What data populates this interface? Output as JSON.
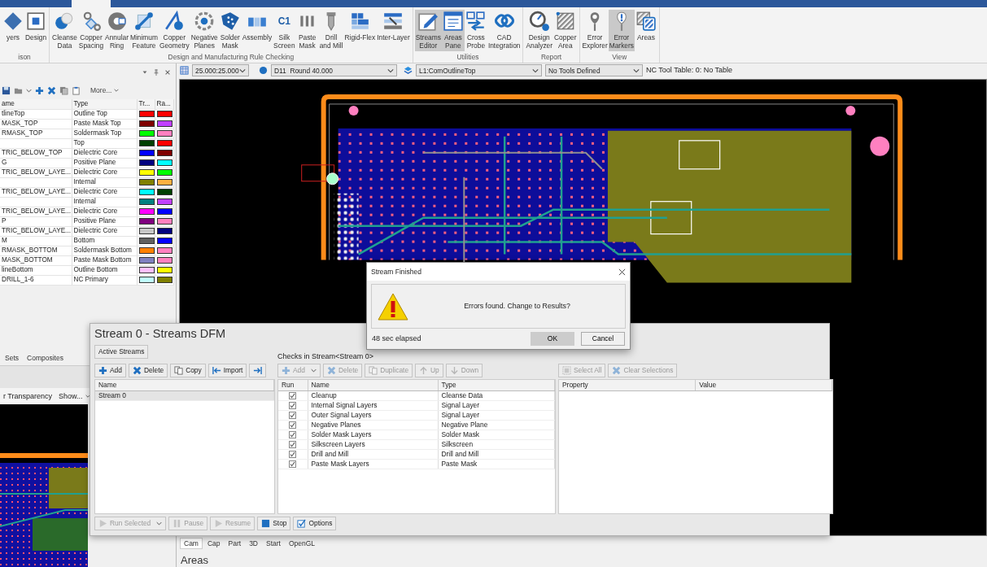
{
  "ribbon": {
    "groups": [
      {
        "label": "ison",
        "buttons": [
          {
            "label": "yers",
            "pressed": false
          },
          {
            "label": "Design",
            "pressed": false
          }
        ]
      },
      {
        "label": "Design and Manufacturing Rule Checking",
        "buttons": [
          {
            "label": "Cleanse\nData",
            "pressed": false
          },
          {
            "label": "Copper\nSpacing",
            "pressed": false
          },
          {
            "label": "Annular\nRing",
            "pressed": false
          },
          {
            "label": "Minimum\nFeature",
            "pressed": false
          },
          {
            "label": "Copper\nGeometry",
            "pressed": false
          },
          {
            "label": "Negative\nPlanes",
            "pressed": false
          },
          {
            "label": "Solder\nMask",
            "pressed": false
          },
          {
            "label": "Assembly",
            "pressed": false
          },
          {
            "label": "Silk\nScreen",
            "icon_text": "C1",
            "pressed": false
          },
          {
            "label": "Paste\nMask",
            "pressed": false
          },
          {
            "label": "Drill\nand Mill",
            "pressed": false
          },
          {
            "label": "Rigid-Flex",
            "pressed": false
          },
          {
            "label": "Inter-Layer",
            "pressed": false
          }
        ]
      },
      {
        "label": "Utilities",
        "buttons": [
          {
            "label": "Streams\nEditor",
            "pressed": true
          },
          {
            "label": "Areas\nPane",
            "pressed": true
          },
          {
            "label": "Cross\nProbe",
            "pressed": false
          },
          {
            "label": "CAD\nIntegration",
            "pressed": false
          }
        ]
      },
      {
        "label": "Report",
        "buttons": [
          {
            "label": "Design\nAnalyzer",
            "pressed": false
          },
          {
            "label": "Copper\nArea",
            "pressed": false
          }
        ]
      },
      {
        "label": "View",
        "buttons": [
          {
            "label": "Error\nExplorer",
            "pressed": false
          },
          {
            "label": "Error\nMarkers",
            "pressed": true
          },
          {
            "label": "Areas",
            "pressed": false
          }
        ]
      }
    ]
  },
  "toolbar": {
    "grid": "25.000:25.000",
    "dcode": "D11  Round 40.000",
    "layer": "L1:ComOutlineTop",
    "tools": "No Tools Defined",
    "nc_tool_table": "NC Tool Table: 0: No Table"
  },
  "layers_panel": {
    "more": "More...",
    "columns": [
      "ame",
      "Type",
      "Tr...",
      "Ra..."
    ],
    "rows": [
      {
        "name": "tlineTop",
        "type": "Outline Top",
        "colors": [
          {
            "color": "#ff0000"
          },
          {
            "color": "#ff0000"
          }
        ]
      },
      {
        "name": "MASK_TOP",
        "type": "Paste Mask Top",
        "colors": [
          {
            "color": "#800000"
          },
          {
            "color": "#c040ff"
          }
        ]
      },
      {
        "name": "RMASK_TOP",
        "type": "Soldermask Top",
        "colors": [
          {
            "color": "#00ff00"
          },
          {
            "color": "#ff80c0"
          }
        ]
      },
      {
        "type": "Top",
        "colors": [
          {
            "color": "#004000"
          },
          {
            "color": "#ff0000"
          }
        ]
      },
      {
        "name": "TRIC_BELOW_TOP",
        "type": "Dielectric Core",
        "colors": [
          {
            "color": "#0000ff"
          },
          {
            "color": "#800000"
          }
        ]
      },
      {
        "name": "G",
        "type": "Positive Plane",
        "colors": [
          {
            "color": "#000080"
          },
          {
            "color": "#00ffff"
          }
        ]
      },
      {
        "name": "TRIC_BELOW_LAYE...",
        "type": "Dielectric Core",
        "colors": [
          {
            "color": "#ffff00"
          },
          {
            "color": "#00ff00"
          }
        ]
      },
      {
        "type": "Internal",
        "colors": [
          {
            "color": "#808000"
          },
          {
            "color": "#ffb040"
          }
        ]
      },
      {
        "name": "TRIC_BELOW_LAYE...",
        "type": "Dielectric Core",
        "colors": [
          {
            "color": "#00ffff"
          },
          {
            "color": "#004000"
          }
        ]
      },
      {
        "type": "Internal",
        "colors": [
          {
            "color": "#008080"
          },
          {
            "color": "#c040ff"
          }
        ]
      },
      {
        "name": "TRIC_BELOW_LAYE...",
        "type": "Dielectric Core",
        "colors": [
          {
            "color": "#ff00ff"
          },
          {
            "color": "#0000ff"
          }
        ]
      },
      {
        "name": "P",
        "type": "Positive Plane",
        "colors": [
          {
            "color": "#800080"
          },
          {
            "color": "#ff80c0"
          }
        ]
      },
      {
        "name": "TRIC_BELOW_LAYE...",
        "type": "Dielectric Core",
        "colors": [
          {
            "color": "#c8c8c8"
          },
          {
            "color": "#000080"
          }
        ]
      },
      {
        "name": "M",
        "type": "Bottom",
        "colors": [
          {
            "color": "#606060"
          },
          {
            "color": "#0000ff"
          }
        ]
      },
      {
        "name": "RMASK_BOTTOM",
        "type": "Soldermask Bottom",
        "colors": [
          {
            "color": "#ff8000"
          },
          {
            "color": "#ff80c0"
          }
        ]
      },
      {
        "name": "MASK_BOTTOM",
        "type": "Paste Mask Bottom",
        "colors": [
          {
            "color": "#8080c0"
          },
          {
            "color": "#ff80c0"
          }
        ]
      },
      {
        "name": "lineBottom",
        "type": "Outline Bottom",
        "colors": [
          {
            "color": "#ffc0ff"
          },
          {
            "color": "#ffff00"
          }
        ]
      },
      {
        "name": "DRILL_1-6",
        "type": "NC Primary",
        "colors": [
          {
            "color": "#c0ffff"
          },
          {
            "color": "#808000"
          }
        ]
      }
    ]
  },
  "lower_left_panel": {
    "tabs": [
      {
        "label": "Sets",
        "selected": false
      },
      {
        "label": "Composites",
        "selected": false
      }
    ],
    "transparency": "r Transparency",
    "show": "Show..."
  },
  "streams_window": {
    "title": "Stream 0 - Streams DFM",
    "active_streams": "Active Streams",
    "stream_buttons": [
      {
        "kind": "add",
        "label": "Add",
        "disabled": false
      },
      {
        "kind": "delete",
        "label": "Delete",
        "disabled": false
      },
      {
        "kind": "copy",
        "label": "Copy",
        "disabled": false
      },
      {
        "kind": "import",
        "label": "Import",
        "disabled": false
      },
      {
        "kind": "export",
        "disabled": false
      }
    ],
    "streams_column": "Name",
    "streams": [
      {
        "name": "Stream 0",
        "selected": true
      }
    ],
    "checks_label": "Checks in Stream<Stream 0>",
    "check_buttons": [
      {
        "kind": "add",
        "label": "Add",
        "dropdown": true,
        "disabled": true
      },
      {
        "kind": "delete",
        "label": "Delete",
        "disabled": true
      },
      {
        "kind": "copy",
        "label": "Duplicate",
        "disabled": true
      },
      {
        "kind": "up",
        "label": "Up",
        "disabled": true
      },
      {
        "kind": "down",
        "label": "Down",
        "disabled": true
      }
    ],
    "checks_columns": [
      "Run",
      "Name",
      "Type"
    ],
    "checks": [
      {
        "name": "Cleanup",
        "type": "Cleanse Data",
        "checked": true
      },
      {
        "name": "Internal Signal Layers",
        "type": "Signal Layer",
        "checked": true
      },
      {
        "name": "Outer Signal Layers",
        "type": "Signal Layer",
        "checked": true
      },
      {
        "name": "Negative Planes",
        "type": "Negative Plane",
        "checked": true
      },
      {
        "name": "Solder Mask Layers",
        "type": "Solder Mask",
        "checked": true
      },
      {
        "name": "Silkscreen Layers",
        "type": "Silkscreen",
        "checked": true
      },
      {
        "name": "Drill and Mill",
        "type": "Drill and Mill",
        "checked": true
      },
      {
        "name": "Paste Mask Layers",
        "type": "Paste Mask",
        "checked": true
      }
    ],
    "property_buttons": [
      {
        "kind": "select",
        "label": "Select All",
        "disabled": true
      },
      {
        "kind": "delete",
        "label": "Clear Selections",
        "disabled": true
      }
    ],
    "property_columns": [
      "Property",
      "Value"
    ],
    "run_buttons": [
      {
        "kind": "run",
        "label": "Run Selected",
        "dropdown": true,
        "disabled": true
      },
      {
        "kind": "pause",
        "label": "Pause",
        "disabled": true
      },
      {
        "kind": "resume",
        "label": "Resume",
        "disabled": true
      },
      {
        "kind": "stop",
        "label": "Stop",
        "disabled": false
      },
      {
        "kind": "options",
        "label": "Options",
        "disabled": false
      }
    ]
  },
  "dialog": {
    "title": "Stream Finished",
    "message": "Errors found. Change to Results?",
    "elapsed": "48 sec elapsed",
    "buttons": [
      {
        "label": "OK",
        "default": true
      },
      {
        "label": "Cancel",
        "default": false
      }
    ]
  },
  "bottom_pane": {
    "tabs": [
      {
        "label": "Cam",
        "selected": true
      },
      {
        "label": "Cap",
        "selected": false
      },
      {
        "label": "Part",
        "selected": false
      },
      {
        "label": "3D",
        "selected": false
      },
      {
        "label": "Start",
        "selected": false
      },
      {
        "label": "OpenGL",
        "selected": false
      }
    ],
    "heading": "Areas"
  }
}
